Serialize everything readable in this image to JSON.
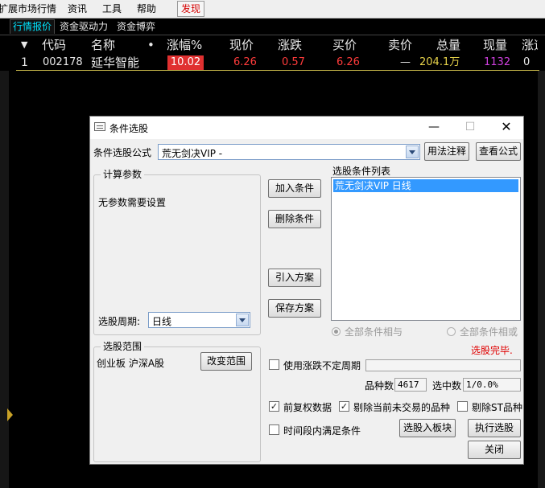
{
  "menu": {
    "items": [
      "扩展市场行情",
      "资讯",
      "工具",
      "帮助",
      "发现"
    ]
  },
  "tabs": [
    "行情报价",
    "资金驱动力",
    "资金博弈"
  ],
  "quote_table": {
    "headers": [
      "代码",
      "名称",
      "•",
      "涨幅%",
      "现价",
      "涨跌",
      "买价",
      "卖价",
      "总量",
      "现量",
      "涨速"
    ],
    "row": {
      "index": "1",
      "code": "002178",
      "name": "延华智能",
      "change_pct": "10.02",
      "price": "6.26",
      "change": "0.57",
      "bid": "6.26",
      "ask": "—",
      "volume": "204.1万",
      "current_volume": "1132",
      "speed": "0"
    },
    "colors": {
      "up": "#ff3b3b",
      "volume": "#e6d24a",
      "current_volume": "#d040e0",
      "highlight_bg": "#e03030"
    }
  },
  "dialog": {
    "title": "条件选股",
    "formula_label": "条件选股公式",
    "formula_value": "荒无剑决VIP  -",
    "usage_button": "用法注释",
    "view_button": "查看公式",
    "params_group": "计算参数",
    "params_text": "无参数需要设置",
    "period_label": "选股周期:",
    "period_value": "日线",
    "add_condition": "加入条件",
    "delete_condition": "删除条件",
    "import_plan": "引入方案",
    "save_plan": "保存方案",
    "list_title": "选股条件列表",
    "list_items": [
      "荒无剑决VIP  日线"
    ],
    "radio_and": "全部条件相与",
    "radio_or": "全部条件相或",
    "status": "选股完毕.",
    "scope_group": "选股范围",
    "scope_text": "创业板 沪深A股",
    "change_scope": "改变范围",
    "use_limit_period": "使用涨跌不定周期",
    "count_label": "品种数",
    "count_value": "4617",
    "selected_label": "选中数",
    "selected_value": "1/0.0%",
    "fq_label": "前复权数据",
    "exclude_inactive": "剔除当前未交易的品种",
    "exclude_st": "剔除ST品种",
    "time_range": "时间段内满足条件",
    "to_block": "选股入板块",
    "execute": "执行选股",
    "close": "关闭"
  }
}
